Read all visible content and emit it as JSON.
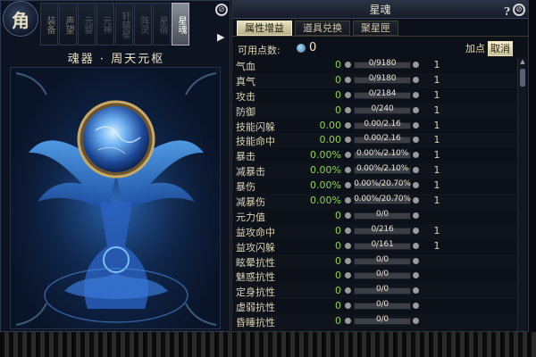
{
  "left_panel": {
    "emblem": "角",
    "tabs": [
      {
        "label": "装备",
        "state": "normal"
      },
      {
        "label": "声望",
        "state": "normal"
      },
      {
        "label": "元婴",
        "state": "dim"
      },
      {
        "label": "元神",
        "state": "dim"
      },
      {
        "label": "轩辕星",
        "state": "dim"
      },
      {
        "label": "阵灵",
        "state": "dim"
      },
      {
        "label": "星宿",
        "state": "dim"
      },
      {
        "label": "星魂",
        "state": "active"
      }
    ],
    "title": "魂器 · 周天元枢",
    "close_icon": "close-icon",
    "arrow_icon": "right-arrow-icon"
  },
  "right_panel": {
    "title": "星魂",
    "help": "?",
    "tabs": [
      {
        "label": "属性增益",
        "active": true
      },
      {
        "label": "道具兑换",
        "active": false
      },
      {
        "label": "聚星匣",
        "active": false
      }
    ],
    "points_label": "可用点数:",
    "points_value": "0",
    "add_label": "加点",
    "cancel_label": "取消",
    "rows": [
      {
        "name": "气血",
        "value": "0",
        "progress": "0/9180",
        "level": "1"
      },
      {
        "name": "真气",
        "value": "0",
        "progress": "0/9180",
        "level": "1"
      },
      {
        "name": "攻击",
        "value": "0",
        "progress": "0/2184",
        "level": "1"
      },
      {
        "name": "防御",
        "value": "0",
        "progress": "0/240",
        "level": "1"
      },
      {
        "name": "技能闪躲",
        "value": "0.00",
        "progress": "0.00/2.16",
        "level": "1"
      },
      {
        "name": "技能命中",
        "value": "0.00",
        "progress": "0.00/2.16",
        "level": "1"
      },
      {
        "name": "暴击",
        "value": "0.00%",
        "progress": "0.00%/2.10%",
        "level": "1"
      },
      {
        "name": "减暴击",
        "value": "0.00%",
        "progress": "0.00%/2.10%",
        "level": "1"
      },
      {
        "name": "暴伤",
        "value": "0.00%",
        "progress": "0.00%/20.70%",
        "level": "1"
      },
      {
        "name": "减暴伤",
        "value": "0.00%",
        "progress": "0.00%/20.70%",
        "level": "1"
      },
      {
        "name": "元力值",
        "value": "0",
        "progress": "0/0",
        "level": ""
      },
      {
        "name": "益攻命中",
        "value": "0",
        "progress": "0/216",
        "level": "1"
      },
      {
        "name": "益攻闪躲",
        "value": "0",
        "progress": "0/161",
        "level": "1"
      },
      {
        "name": "眩晕抗性",
        "value": "0",
        "progress": "0/0",
        "level": ""
      },
      {
        "name": "魅惑抗性",
        "value": "0",
        "progress": "0/0",
        "level": ""
      },
      {
        "name": "定身抗性",
        "value": "0",
        "progress": "0/0",
        "level": ""
      },
      {
        "name": "虚弱抗性",
        "value": "0",
        "progress": "0/0",
        "level": ""
      },
      {
        "name": "昏睡抗性",
        "value": "0",
        "progress": "0/0",
        "level": ""
      }
    ]
  },
  "colors": {
    "value_green": "#8fd44a",
    "gold_text": "#d6cfae",
    "active_tab": "#e8e2c0"
  }
}
